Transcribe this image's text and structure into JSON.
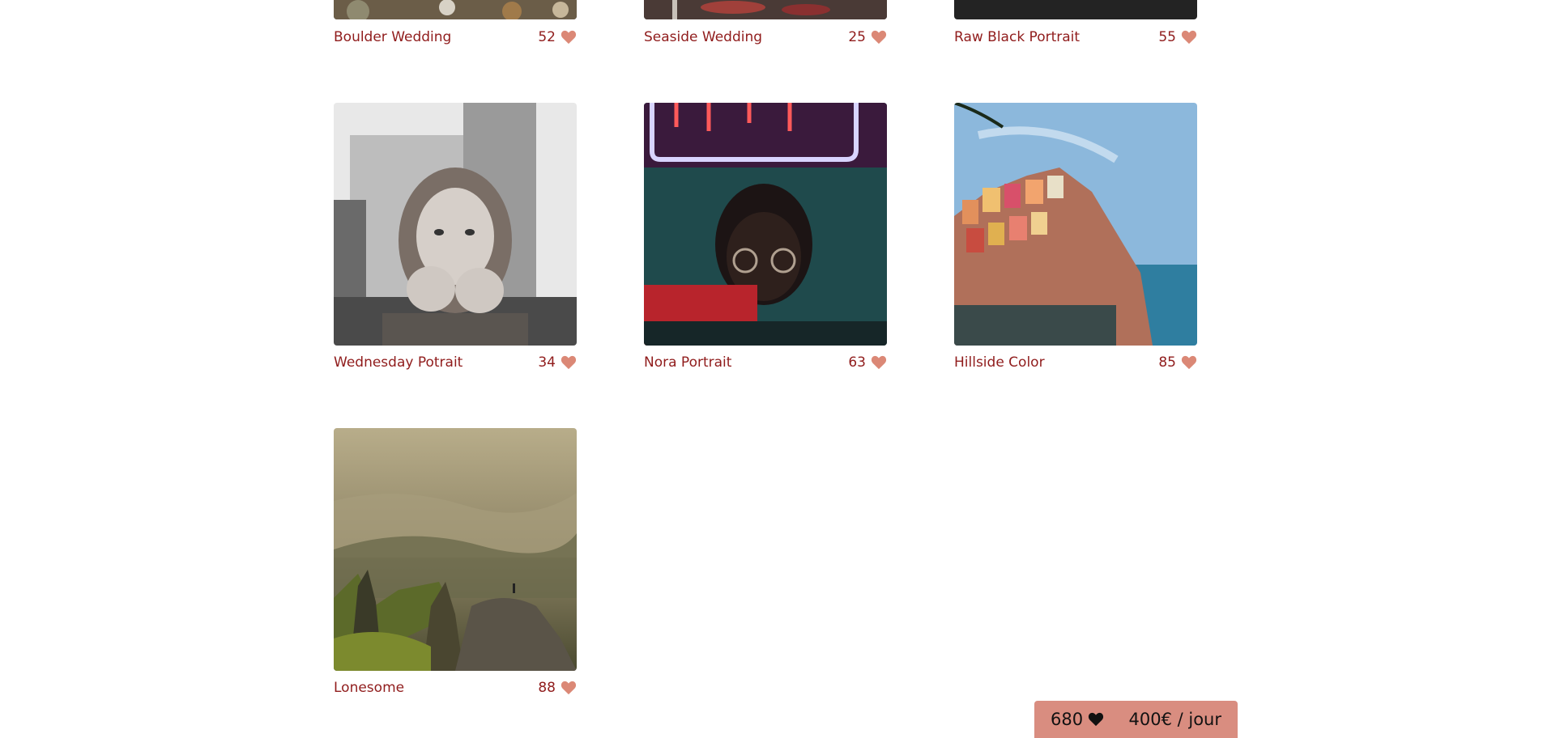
{
  "colors": {
    "caption_text": "#901c1c",
    "heart": "#db8876",
    "stats_bar_bg": "#d98d80"
  },
  "photos": [
    {
      "title": "Boulder Wedding",
      "likes": "52"
    },
    {
      "title": "Seaside Wedding",
      "likes": "25"
    },
    {
      "title": "Raw Black Portrait",
      "likes": "55"
    },
    {
      "title": "Wednesday Potrait",
      "likes": "34"
    },
    {
      "title": "Nora Portrait",
      "likes": "63"
    },
    {
      "title": "Hillside Color",
      "likes": "85"
    },
    {
      "title": "Lonesome",
      "likes": "88"
    }
  ],
  "stats": {
    "total_likes": "680",
    "price": "400€ / jour"
  }
}
